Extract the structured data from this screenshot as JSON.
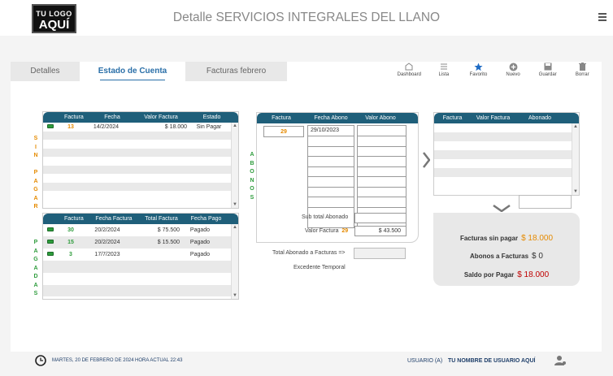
{
  "header": {
    "logo_line1": "TU LOGO",
    "logo_line2": "AQUÍ",
    "title": "Detalle SERVICIOS INTEGRALES DEL LLANO"
  },
  "tabs": [
    {
      "label": "Detalles"
    },
    {
      "label": "Estado de Cuenta"
    },
    {
      "label": "Facturas febrero"
    }
  ],
  "toolbar": [
    {
      "label": "Dashboard",
      "icon": "dashboard-icon"
    },
    {
      "label": "Lista",
      "icon": "list-icon"
    },
    {
      "label": "Favorito",
      "icon": "star-icon"
    },
    {
      "label": "Nuevo",
      "icon": "plus-circle-icon"
    },
    {
      "label": "Guardar",
      "icon": "save-icon"
    },
    {
      "label": "Borrar",
      "icon": "trash-icon"
    }
  ],
  "sin_pagar": {
    "vertical_label": "SIN PAGAR",
    "columns": [
      "Factura",
      "Fecha",
      "Valor Factura",
      "Estado"
    ],
    "rows": [
      {
        "factura": "13",
        "fecha": "14/2/2024",
        "valor": "$ 18.000",
        "estado": "Sin Pagar"
      }
    ]
  },
  "pagadas": {
    "vertical_label": "PAGADAS",
    "columns": [
      "Factura",
      "Fecha Factura",
      "Total Factura",
      "Fecha Pago"
    ],
    "rows": [
      {
        "factura": "30",
        "fecha": "20/2/2024",
        "total": "$ 75.500",
        "pago": "Pagado"
      },
      {
        "factura": "15",
        "fecha": "20/2/2024",
        "total": "$ 15.500",
        "pago": "Pagado"
      },
      {
        "factura": "3",
        "fecha": "17/7/2023",
        "total": "",
        "pago": "Pagado"
      }
    ]
  },
  "abonos": {
    "vertical_label": "ABONOS",
    "columns": [
      "Factura",
      "Fecha Abono",
      "Valor Abono"
    ],
    "factura": "29",
    "first_fecha": "29/10/2023",
    "subtotal_label": "Sub total Abonado",
    "valor_factura_label": "Valor Factura",
    "valor_factura_num": "29",
    "valor_factura_value": "$ 43.500",
    "total_abonado_label": "Total Abonado a Facturas =>",
    "excedente_label": "Excedente Temporal"
  },
  "right_table": {
    "columns": [
      "Factura",
      "Valor Factura",
      "Abonado"
    ]
  },
  "summary": {
    "sin_pagar_label": "Facturas sin pagar",
    "sin_pagar_value": "$ 18.000",
    "abonos_label": "Abonos a Facturas",
    "abonos_value": "$ 0",
    "saldo_label": "Saldo por Pagar",
    "saldo_value": "$ 18.000"
  },
  "footer": {
    "date": "MARTES, 20 DE FEBRERO DE 2024",
    "time": "HORA ACTUAL 22:43",
    "user_prefix": "USUARIO (A)",
    "user_name": "TU NOMBRE DE USUARIO AQUÍ"
  },
  "colors": {
    "header_blue": "#1f5f7a",
    "orange": "#e58a00",
    "green": "#2e9c3c",
    "red": "#c00000",
    "tab_active": "#2a6fa8"
  }
}
